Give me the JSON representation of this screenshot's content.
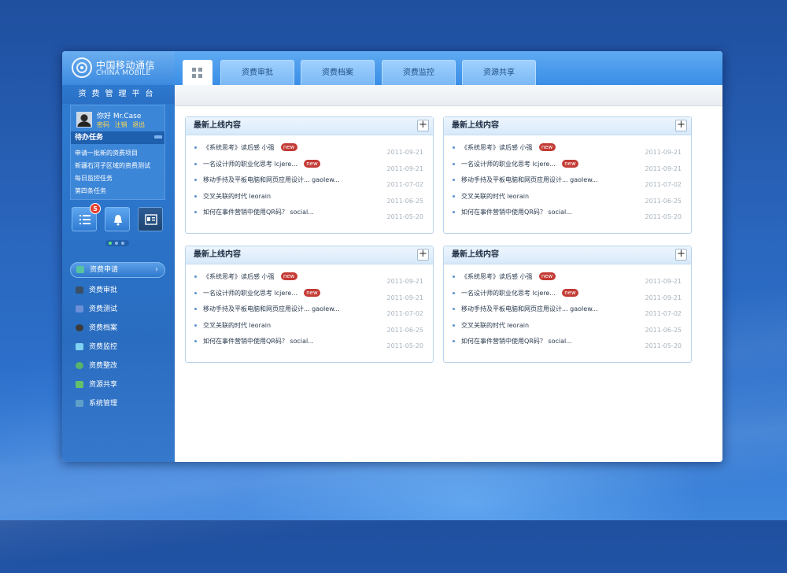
{
  "brand": {
    "name_cn": "中国移动通信",
    "name_en": "CHINA MOBILE",
    "platform": "资费管理平台"
  },
  "user": {
    "greeting": "你好 Mr.Case",
    "links": [
      "密码",
      "注销",
      "退出"
    ]
  },
  "todo": {
    "title": "待办任务",
    "items": [
      "申请一批新的资费项目",
      "新疆石河子区域的资费测试",
      "每日监控任务",
      "第四条任务"
    ]
  },
  "quick_actions": {
    "notification_count": "5"
  },
  "menu": [
    {
      "label": "资费申请",
      "icon": "apply-icon",
      "active": true
    },
    {
      "label": "资费审批",
      "icon": "approve-icon"
    },
    {
      "label": "资费测试",
      "icon": "test-icon"
    },
    {
      "label": "资费档案",
      "icon": "archive-icon"
    },
    {
      "label": "资费监控",
      "icon": "monitor-icon"
    },
    {
      "label": "资费整改",
      "icon": "rectify-icon"
    },
    {
      "label": "资源共享",
      "icon": "share-icon"
    },
    {
      "label": "系统管理",
      "icon": "settings-icon"
    }
  ],
  "tabs": [
    "资费审批",
    "资费档案",
    "资费监控",
    "资源共享"
  ],
  "panels": [
    {
      "title": "最新上线内容"
    },
    {
      "title": "最新上线内容"
    },
    {
      "title": "最新上线内容"
    },
    {
      "title": "最新上线内容"
    }
  ],
  "panel_rows": [
    {
      "text": "《系统思考》读后感 小强",
      "new": true,
      "date": "2011-09-21"
    },
    {
      "text": "一名设计师的职业化思考 lcjere...",
      "new": true,
      "date": "2011-09-21"
    },
    {
      "text": "移动手持及平板电脑和网页应用设计... gaolew...",
      "new": false,
      "date": "2011-07-02"
    },
    {
      "text": "交叉关联的时代 leorain",
      "new": false,
      "date": "2011-06-25"
    },
    {
      "text": "如何在事件营销中使用QR码？ social...",
      "new": false,
      "date": "2011-05-20"
    }
  ],
  "new_label": "new",
  "colors": {
    "accent": "#3a8ee6",
    "badge": "#e33f2f",
    "new_tag": "#c33b35"
  }
}
